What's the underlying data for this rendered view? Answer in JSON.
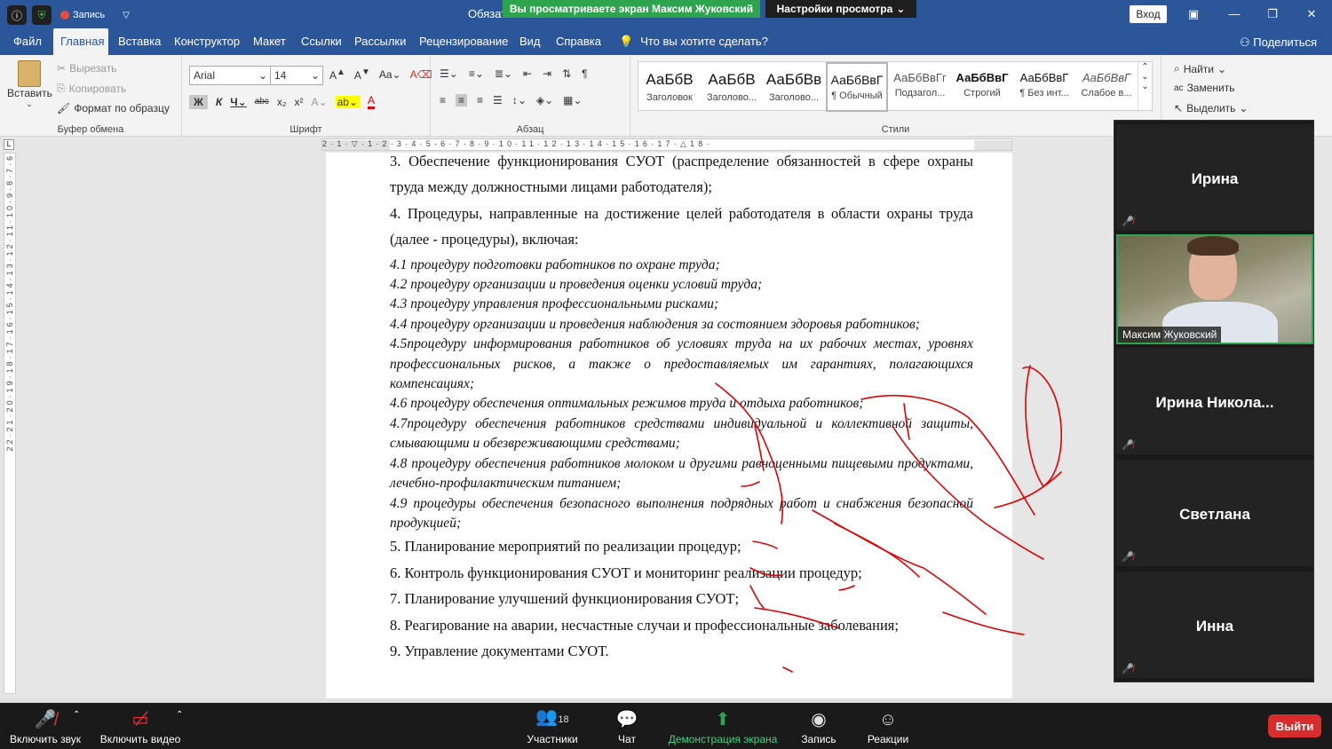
{
  "titlebar": {
    "rec_label": "Запись",
    "doc_title": "Обязат",
    "signin": "Вход"
  },
  "zoom": {
    "share_banner": "Вы просматриваете экран Максим Жуковский",
    "view_options": "Настройки просмотра",
    "participants": [
      "Ирина",
      "Ирина  Никола...",
      "Светлана",
      "Инна"
    ],
    "video_name": "Максим Жуковский",
    "toolbar": {
      "audio": "Включить звук",
      "video": "Включить видео",
      "participants": "Участники",
      "participants_count": "18",
      "chat": "Чат",
      "share": "Демонстрация экрана",
      "record": "Запись",
      "reactions": "Реакции",
      "leave": "Выйти"
    }
  },
  "menu": {
    "tabs": [
      "Файл",
      "Главная",
      "Вставка",
      "Конструктор",
      "Макет",
      "Ссылки",
      "Рассылки",
      "Рецензирование",
      "Вид",
      "Справка"
    ],
    "tell_me": "Что вы хотите сделать?",
    "share": "Поделиться"
  },
  "ribbon": {
    "clipboard": {
      "paste": "Вставить",
      "cut": "Вырезать",
      "copy": "Копировать",
      "format_painter": "Формат по образцу",
      "label": "Буфер обмена"
    },
    "font": {
      "name": "Arial",
      "size": "14",
      "label": "Шрифт"
    },
    "paragraph": {
      "label": "Абзац"
    },
    "styles": {
      "label": "Стили",
      "items": [
        {
          "sample": "АаБбВ",
          "name": "Заголовок"
        },
        {
          "sample": "АаБбВ",
          "name": "Заголово..."
        },
        {
          "sample": "АаБбВв",
          "name": "Заголово..."
        },
        {
          "sample": "АаБбВвГ",
          "name": "¶ Обычный"
        },
        {
          "sample": "АаБбВвГг",
          "name": "Подзагол..."
        },
        {
          "sample": "АаБбВвГ",
          "name": "Строгий"
        },
        {
          "sample": "АаБбВвГ",
          "name": "¶ Без инт..."
        },
        {
          "sample": "АаБбВвГ",
          "name": "Слабое в..."
        }
      ]
    },
    "editing": {
      "find": "Найти",
      "replace": "Заменить",
      "select": "Выделить"
    }
  },
  "document": {
    "paragraphs": [
      "3. Обеспечение функционирования СУОТ (распределение обязанностей в сфере охраны труда между должностными лицами работодателя);",
      "4. Процедуры, направленные на достижение целей работодателя в области охраны труда (далее - процедуры), включая:"
    ],
    "items": [
      "4.1 процедуру подготовки работников по охране труда;",
      "4.2 процедуру организации и проведения оценки условий труда;",
      "4.3 процедуру управления профессиональными рисками;",
      "4.4 процедуру организации и проведения наблюдения за состоянием здоровья работников;",
      "4.5процедуру информирования работников об условиях труда на их рабочих местах, уровнях профессиональных рисков, а также о предоставляемых им гарантиях, полагающихся компенсациях;",
      "4.6 процедуру обеспечения оптимальных режимов труда и отдыха работников;",
      "4.7процедуру обеспечения работников средствами индивидуальной и коллективной защиты, смывающими и обезвреживающими средствами;",
      "4.8 процедуру обеспечения работников молоком и другими равноценными пищевыми продуктами, лечебно-профилактическим питанием;",
      "4.9 процедуры обеспечения безопасного выполнения подрядных работ и снабжения безопасной продукцией;"
    ],
    "closing": [
      "5. Планирование мероприятий по реализации процедур;",
      "6. Контроль функционирования СУОТ и мониторинг реализации процедур;",
      "7. Планирование улучшений функционирования СУОТ;",
      "8. Реагирование на аварии, несчастные случаи и профессиональные заболевания;",
      "9. Управление документами СУОТ."
    ]
  },
  "colors": {
    "word_blue": "#2b579a",
    "zoom_green": "#2ea44f",
    "ink_red": "#e00000",
    "leave_red": "#d92d2d"
  }
}
